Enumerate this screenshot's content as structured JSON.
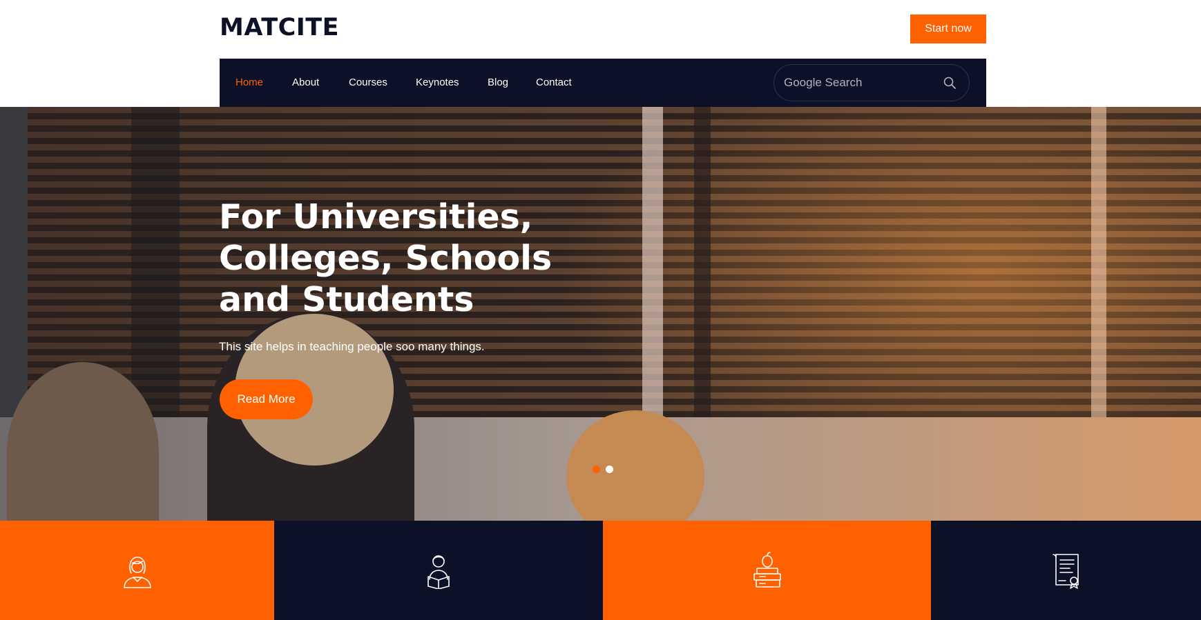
{
  "header": {
    "logo_text": "MATCITE",
    "cta_label": "Start now"
  },
  "nav": {
    "items": [
      {
        "label": "Home",
        "active": true
      },
      {
        "label": "About",
        "active": false
      },
      {
        "label": "Courses",
        "active": false
      },
      {
        "label": "Keynotes",
        "active": false
      },
      {
        "label": "Blog",
        "active": false
      },
      {
        "label": "Contact",
        "active": false
      }
    ],
    "search_placeholder": "Google Search",
    "search_icon": "search-icon"
  },
  "hero": {
    "title_line1": "For Universities,",
    "title_line2": "Colleges, Schools",
    "title_line3": "and Students",
    "subtitle": "This site helps in teaching people soo many things.",
    "button_label": "Read More",
    "slides_total": 2,
    "active_slide": 1
  },
  "features": [
    {
      "icon": "female-student-icon",
      "bg": "#ff6100"
    },
    {
      "icon": "reading-student-icon",
      "bg": "#0c1128"
    },
    {
      "icon": "books-apple-icon",
      "bg": "#ff6100"
    },
    {
      "icon": "certificate-icon",
      "bg": "#0c1128"
    }
  ],
  "colors": {
    "accent": "#ff6100",
    "navy": "#0c1128",
    "white": "#ffffff"
  }
}
